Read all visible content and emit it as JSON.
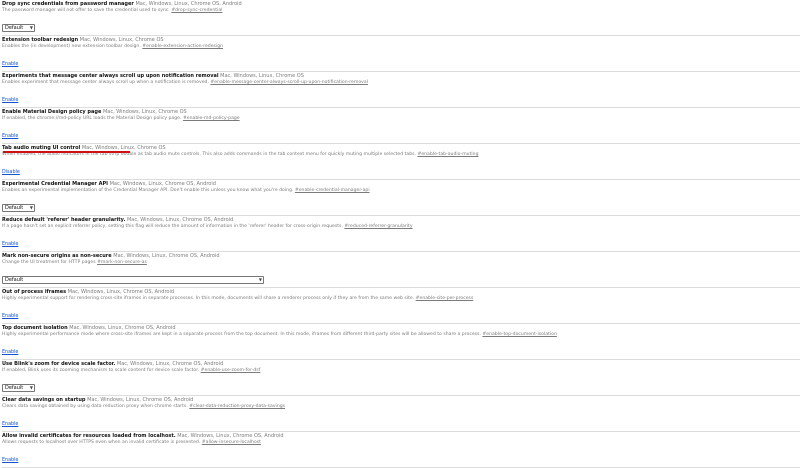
{
  "flags": [
    {
      "name": "Drop sync credentials from password manager",
      "platforms": "Mac, Windows, Linux, Chrome OS, Android",
      "description": "The password manager will not offer to save the credential used to sync.",
      "tag": "#drop-sync-credential",
      "control": "select",
      "select_value": "Default"
    },
    {
      "name": "Extension toolbar redesign",
      "platforms": "Mac, Windows, Linux, Chrome OS",
      "description": "Enables the (in development) new extension toolbar design.",
      "tag": "#enable-extension-action-redesign",
      "control": "link",
      "link_label": "Enable"
    },
    {
      "name": "Experiments that message center always scroll up upon notification removal",
      "platforms": "Mac, Windows, Linux, Chrome OS",
      "description": "Enables experiment that message center always scroll up when a notification is removed.",
      "tag": "#enable-message-center-always-scroll-up-upon-notification-removal",
      "control": "link",
      "link_label": "Enable"
    },
    {
      "name": "Enable Material Design policy page",
      "platforms": "Mac, Windows, Linux, Chrome OS",
      "description": "If enabled, the chrome://md-policy URL loads the Material Design policy page.",
      "tag": "#enable-md-policy-page",
      "control": "link",
      "link_label": "Enable"
    },
    {
      "name": "Tab audio muting UI control",
      "platforms": "Mac, Windows, Linux, Chrome OS",
      "description": "When enabled, the audio indicators in the tab strip double as tab audio mute controls. This also adds commands in the tab context menu for quickly muting multiple selected tabs.",
      "tag": "#enable-tab-audio-muting",
      "control": "link",
      "link_label": "Disable",
      "highlighted": true
    },
    {
      "name": "Experimental Credential Manager API",
      "platforms": "Mac, Windows, Linux, Chrome OS, Android",
      "description": "Enables an experimental implementation of the Credential Manager API. Don't enable this unless you know what you're doing.",
      "tag": "#enable-credential-manager-api",
      "control": "select",
      "select_value": "Default"
    },
    {
      "name": "Reduce default 'referer' header granularity.",
      "platforms": "Mac, Windows, Linux, Chrome OS, Android",
      "description": "If a page hasn't set an explicit referrer policy, setting this flag will reduce the amount of information in the 'referer' header for cross-origin requests.",
      "tag": "#reduced-referrer-granularity",
      "control": "link",
      "link_label": "Enable"
    },
    {
      "name": "Mark non-secure origins as non-secure",
      "platforms": "Mac, Windows, Linux, Chrome OS, Android",
      "description": "Change the UI treatment for HTTP pages",
      "tag": "#mark-non-secure-as",
      "control": "select-large",
      "select_value": "Default"
    },
    {
      "name": "Out of process iframes",
      "platforms": "Mac, Windows, Linux, Chrome OS, Android",
      "description": "Highly experimental support for rendering cross-site iframes in separate processes. In this mode, documents will share a renderer process only if they are from the same web site.",
      "tag": "#enable-site-per-process",
      "control": "link",
      "link_label": "Enable"
    },
    {
      "name": "Top document isolation",
      "platforms": "Mac, Windows, Linux, Chrome OS, Android",
      "description": "Highly experimental performance mode where cross-site iframes are kept in a separate process from the top document. In this mode, iframes from different third-party sites will be allowed to share a process.",
      "tag": "#enable-top-document-isolation",
      "control": "link",
      "link_label": "Enable"
    },
    {
      "name": "Use Blink's zoom for device scale factor.",
      "platforms": "Mac, Windows, Linux, Chrome OS, Android",
      "description": "If enabled, Blink uses its zooming mechanism to scale content for device scale factor.",
      "tag": "#enable-use-zoom-for-dsf",
      "control": "select",
      "select_value": "Default"
    },
    {
      "name": "Clear data savings on startup",
      "platforms": "Mac, Windows, Linux, Chrome OS, Android",
      "description": "Clears data savings obtained by using data reduction proxy when chrome starts.",
      "tag": "#clear-data-reduction-proxy-data-savings",
      "control": "link",
      "link_label": "Enable"
    },
    {
      "name": "Allow invalid certificates for resources loaded from localhost.",
      "platforms": "Mac, Windows, Linux, Chrome OS, Android",
      "description": "Allows requests to localhost over HTTPS even when an invalid certificate is presented.",
      "tag": "#allow-insecure-localhost",
      "control": "link",
      "link_label": "Enable"
    }
  ],
  "colors": {
    "link": "#1155cc",
    "highlight": "#d01010",
    "divider": "#dcdcdc",
    "muted_text": "#7b7b7b"
  }
}
